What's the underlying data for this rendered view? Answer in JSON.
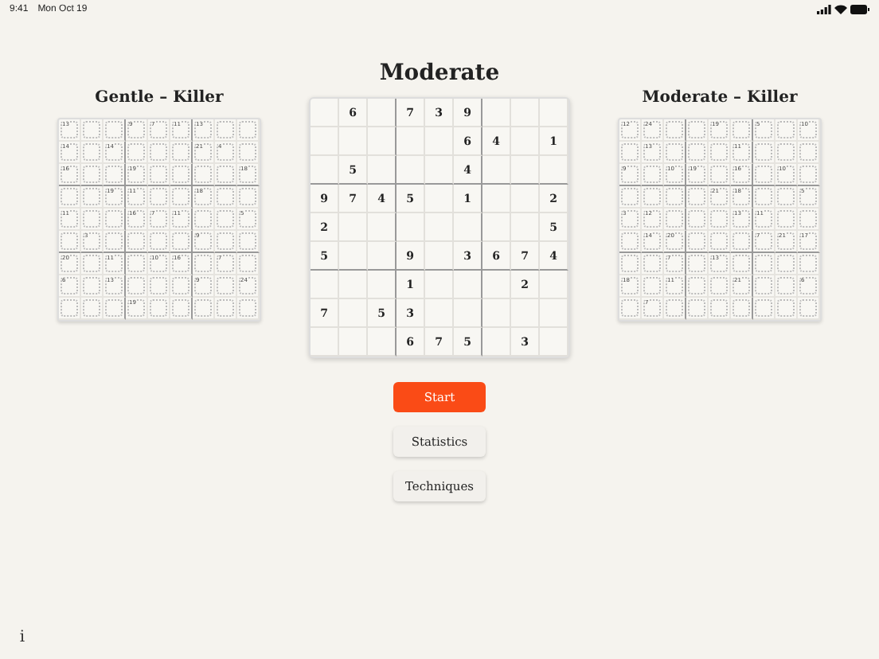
{
  "status_bar": {
    "time": "9:41",
    "date": "Mon Oct 19"
  },
  "title": "Moderate",
  "puzzle": {
    "rows": [
      [
        {
          "kind": "empty"
        },
        {
          "kind": "given",
          "digit": "6"
        },
        {
          "kind": "empty"
        },
        {
          "kind": "given",
          "digit": "7"
        },
        {
          "kind": "given",
          "digit": "3"
        },
        {
          "kind": "given",
          "digit": "9"
        },
        {
          "kind": "empty"
        },
        {
          "kind": "empty"
        },
        {
          "kind": "empty"
        }
      ],
      [
        {
          "kind": "empty"
        },
        {
          "kind": "empty"
        },
        {
          "kind": "empty"
        },
        {
          "kind": "empty"
        },
        {
          "kind": "empty"
        },
        {
          "kind": "given",
          "digit": "6"
        },
        {
          "kind": "given",
          "digit": "4"
        },
        {
          "kind": "empty"
        },
        {
          "kind": "given",
          "digit": "1"
        }
      ],
      [
        {
          "kind": "empty"
        },
        {
          "kind": "given",
          "digit": "5"
        },
        {
          "kind": "empty"
        },
        {
          "kind": "empty"
        },
        {
          "kind": "empty"
        },
        {
          "kind": "given",
          "digit": "4"
        },
        {
          "kind": "empty"
        },
        {
          "kind": "empty"
        },
        {
          "kind": "empty"
        }
      ],
      [
        {
          "kind": "given",
          "digit": "9"
        },
        {
          "kind": "given",
          "digit": "7"
        },
        {
          "kind": "given",
          "digit": "4"
        },
        {
          "kind": "given",
          "digit": "5"
        },
        {
          "kind": "empty"
        },
        {
          "kind": "given",
          "digit": "1"
        },
        {
          "kind": "empty"
        },
        {
          "kind": "empty"
        },
        {
          "kind": "given",
          "digit": "2"
        }
      ],
      [
        {
          "kind": "given",
          "digit": "2"
        },
        {
          "kind": "empty"
        },
        {
          "kind": "empty"
        },
        {
          "kind": "empty"
        },
        {
          "kind": "empty"
        },
        {
          "kind": "empty"
        },
        {
          "kind": "empty"
        },
        {
          "kind": "empty"
        },
        {
          "kind": "given",
          "digit": "5"
        }
      ],
      [
        {
          "kind": "given",
          "digit": "5"
        },
        {
          "kind": "empty"
        },
        {
          "kind": "empty"
        },
        {
          "kind": "given",
          "digit": "9"
        },
        {
          "kind": "empty"
        },
        {
          "kind": "given",
          "digit": "3"
        },
        {
          "kind": "given",
          "digit": "6"
        },
        {
          "kind": "given",
          "digit": "7"
        },
        {
          "kind": "given",
          "digit": "4"
        }
      ],
      [
        {
          "kind": "empty"
        },
        {
          "kind": "empty"
        },
        {
          "kind": "empty"
        },
        {
          "kind": "given",
          "digit": "1"
        },
        {
          "kind": "empty"
        },
        {
          "kind": "empty"
        },
        {
          "kind": "empty"
        },
        {
          "kind": "given",
          "digit": "2"
        },
        {
          "kind": "empty"
        }
      ],
      [
        {
          "kind": "given",
          "digit": "7"
        },
        {
          "kind": "empty"
        },
        {
          "kind": "given",
          "digit": "5"
        },
        {
          "kind": "given",
          "digit": "3"
        },
        {
          "kind": "empty"
        },
        {
          "kind": "empty"
        },
        {
          "kind": "empty"
        },
        {
          "kind": "empty"
        },
        {
          "kind": "empty"
        }
      ],
      [
        {
          "kind": "empty"
        },
        {
          "kind": "empty"
        },
        {
          "kind": "empty"
        },
        {
          "kind": "given",
          "digit": "6"
        },
        {
          "kind": "given",
          "digit": "7"
        },
        {
          "kind": "given",
          "digit": "5"
        },
        {
          "kind": "empty"
        },
        {
          "kind": "given",
          "digit": "3"
        },
        {
          "kind": "empty"
        }
      ]
    ]
  },
  "side_puzzles": [
    {
      "title": "Gentle – Killer",
      "rows": [
        [
          {
            "kind": "sum",
            "sum": "13"
          },
          {
            "kind": "cell"
          },
          {
            "kind": "cell"
          },
          {
            "kind": "sum",
            "sum": "9"
          },
          {
            "kind": "sum",
            "sum": "7"
          },
          {
            "kind": "sum",
            "sum": "11"
          },
          {
            "kind": "sum",
            "sum": "13"
          },
          {
            "kind": "cell"
          },
          {
            "kind": "cell"
          }
        ],
        [
          {
            "kind": "sum",
            "sum": "14"
          },
          {
            "kind": "cell"
          },
          {
            "kind": "sum",
            "sum": "14"
          },
          {
            "kind": "cell"
          },
          {
            "kind": "cell"
          },
          {
            "kind": "cell"
          },
          {
            "kind": "sum",
            "sum": "21"
          },
          {
            "kind": "sum",
            "sum": "4"
          },
          {
            "kind": "cell"
          }
        ],
        [
          {
            "kind": "sum",
            "sum": "16"
          },
          {
            "kind": "cell"
          },
          {
            "kind": "cell"
          },
          {
            "kind": "sum",
            "sum": "19"
          },
          {
            "kind": "cell"
          },
          {
            "kind": "cell"
          },
          {
            "kind": "cell"
          },
          {
            "kind": "cell"
          },
          {
            "kind": "sum",
            "sum": "18"
          }
        ],
        [
          {
            "kind": "cell"
          },
          {
            "kind": "cell"
          },
          {
            "kind": "sum",
            "sum": "19"
          },
          {
            "kind": "sum",
            "sum": "11"
          },
          {
            "kind": "cell"
          },
          {
            "kind": "cell"
          },
          {
            "kind": "sum",
            "sum": "18"
          },
          {
            "kind": "cell"
          },
          {
            "kind": "cell"
          }
        ],
        [
          {
            "kind": "sum",
            "sum": "11"
          },
          {
            "kind": "cell"
          },
          {
            "kind": "cell"
          },
          {
            "kind": "sum",
            "sum": "16"
          },
          {
            "kind": "sum",
            "sum": "7"
          },
          {
            "kind": "sum",
            "sum": "11"
          },
          {
            "kind": "cell"
          },
          {
            "kind": "cell"
          },
          {
            "kind": "sum",
            "sum": "5"
          }
        ],
        [
          {
            "kind": "cell"
          },
          {
            "kind": "sum",
            "sum": "3"
          },
          {
            "kind": "cell"
          },
          {
            "kind": "cell"
          },
          {
            "kind": "cell"
          },
          {
            "kind": "cell"
          },
          {
            "kind": "sum",
            "sum": "9"
          },
          {
            "kind": "cell"
          },
          {
            "kind": "cell"
          }
        ],
        [
          {
            "kind": "sum",
            "sum": "20"
          },
          {
            "kind": "cell"
          },
          {
            "kind": "sum",
            "sum": "11"
          },
          {
            "kind": "cell"
          },
          {
            "kind": "sum",
            "sum": "10"
          },
          {
            "kind": "sum",
            "sum": "16"
          },
          {
            "kind": "cell"
          },
          {
            "kind": "sum",
            "sum": "7"
          },
          {
            "kind": "cell"
          }
        ],
        [
          {
            "kind": "sum",
            "sum": "6"
          },
          {
            "kind": "cell"
          },
          {
            "kind": "sum",
            "sum": "13"
          },
          {
            "kind": "cell"
          },
          {
            "kind": "cell"
          },
          {
            "kind": "cell"
          },
          {
            "kind": "sum",
            "sum": "9"
          },
          {
            "kind": "cell"
          },
          {
            "kind": "sum",
            "sum": "24"
          }
        ],
        [
          {
            "kind": "cell"
          },
          {
            "kind": "cell"
          },
          {
            "kind": "cell"
          },
          {
            "kind": "sum",
            "sum": "19"
          },
          {
            "kind": "cell"
          },
          {
            "kind": "cell"
          },
          {
            "kind": "cell"
          },
          {
            "kind": "cell"
          },
          {
            "kind": "cell"
          }
        ]
      ]
    },
    {
      "title": "Moderate – Killer",
      "rows": [
        [
          {
            "kind": "sum",
            "sum": "12"
          },
          {
            "kind": "sum",
            "sum": "24"
          },
          {
            "kind": "cell"
          },
          {
            "kind": "cell"
          },
          {
            "kind": "sum",
            "sum": "19"
          },
          {
            "kind": "cell"
          },
          {
            "kind": "sum",
            "sum": "5"
          },
          {
            "kind": "cell"
          },
          {
            "kind": "sum",
            "sum": "10"
          }
        ],
        [
          {
            "kind": "cell"
          },
          {
            "kind": "sum",
            "sum": "13"
          },
          {
            "kind": "cell"
          },
          {
            "kind": "cell"
          },
          {
            "kind": "cell"
          },
          {
            "kind": "sum",
            "sum": "11"
          },
          {
            "kind": "cell"
          },
          {
            "kind": "cell"
          },
          {
            "kind": "cell"
          }
        ],
        [
          {
            "kind": "sum",
            "sum": "9"
          },
          {
            "kind": "cell"
          },
          {
            "kind": "sum",
            "sum": "10"
          },
          {
            "kind": "sum",
            "sum": "19"
          },
          {
            "kind": "cell"
          },
          {
            "kind": "sum",
            "sum": "16"
          },
          {
            "kind": "cell"
          },
          {
            "kind": "sum",
            "sum": "10"
          },
          {
            "kind": "cell"
          }
        ],
        [
          {
            "kind": "cell"
          },
          {
            "kind": "cell"
          },
          {
            "kind": "cell"
          },
          {
            "kind": "cell"
          },
          {
            "kind": "sum",
            "sum": "21"
          },
          {
            "kind": "sum",
            "sum": "18"
          },
          {
            "kind": "cell"
          },
          {
            "kind": "cell"
          },
          {
            "kind": "sum",
            "sum": "5"
          }
        ],
        [
          {
            "kind": "sum",
            "sum": "3"
          },
          {
            "kind": "sum",
            "sum": "12"
          },
          {
            "kind": "cell"
          },
          {
            "kind": "cell"
          },
          {
            "kind": "cell"
          },
          {
            "kind": "sum",
            "sum": "13"
          },
          {
            "kind": "sum",
            "sum": "11"
          },
          {
            "kind": "cell"
          },
          {
            "kind": "cell"
          }
        ],
        [
          {
            "kind": "cell"
          },
          {
            "kind": "sum",
            "sum": "14"
          },
          {
            "kind": "sum",
            "sum": "20"
          },
          {
            "kind": "cell"
          },
          {
            "kind": "cell"
          },
          {
            "kind": "cell"
          },
          {
            "kind": "sum",
            "sum": "7"
          },
          {
            "kind": "sum",
            "sum": "21"
          },
          {
            "kind": "sum",
            "sum": "17"
          }
        ],
        [
          {
            "kind": "cell"
          },
          {
            "kind": "cell"
          },
          {
            "kind": "sum",
            "sum": "7"
          },
          {
            "kind": "cell"
          },
          {
            "kind": "sum",
            "sum": "13"
          },
          {
            "kind": "cell"
          },
          {
            "kind": "cell"
          },
          {
            "kind": "cell"
          },
          {
            "kind": "cell"
          }
        ],
        [
          {
            "kind": "sum",
            "sum": "18"
          },
          {
            "kind": "cell"
          },
          {
            "kind": "sum",
            "sum": "11"
          },
          {
            "kind": "cell"
          },
          {
            "kind": "cell"
          },
          {
            "kind": "sum",
            "sum": "21"
          },
          {
            "kind": "cell"
          },
          {
            "kind": "cell"
          },
          {
            "kind": "sum",
            "sum": "6"
          }
        ],
        [
          {
            "kind": "cell"
          },
          {
            "kind": "sum",
            "sum": "7"
          },
          {
            "kind": "cell"
          },
          {
            "kind": "cell"
          },
          {
            "kind": "cell"
          },
          {
            "kind": "cell"
          },
          {
            "kind": "cell"
          },
          {
            "kind": "cell"
          },
          {
            "kind": "cell"
          }
        ]
      ]
    }
  ],
  "buttons": [
    {
      "label": "Start",
      "kind": "primary"
    },
    {
      "label": "Statistics",
      "kind": "secondary"
    },
    {
      "label": "Techniques",
      "kind": "secondary"
    }
  ],
  "info_button": "i"
}
